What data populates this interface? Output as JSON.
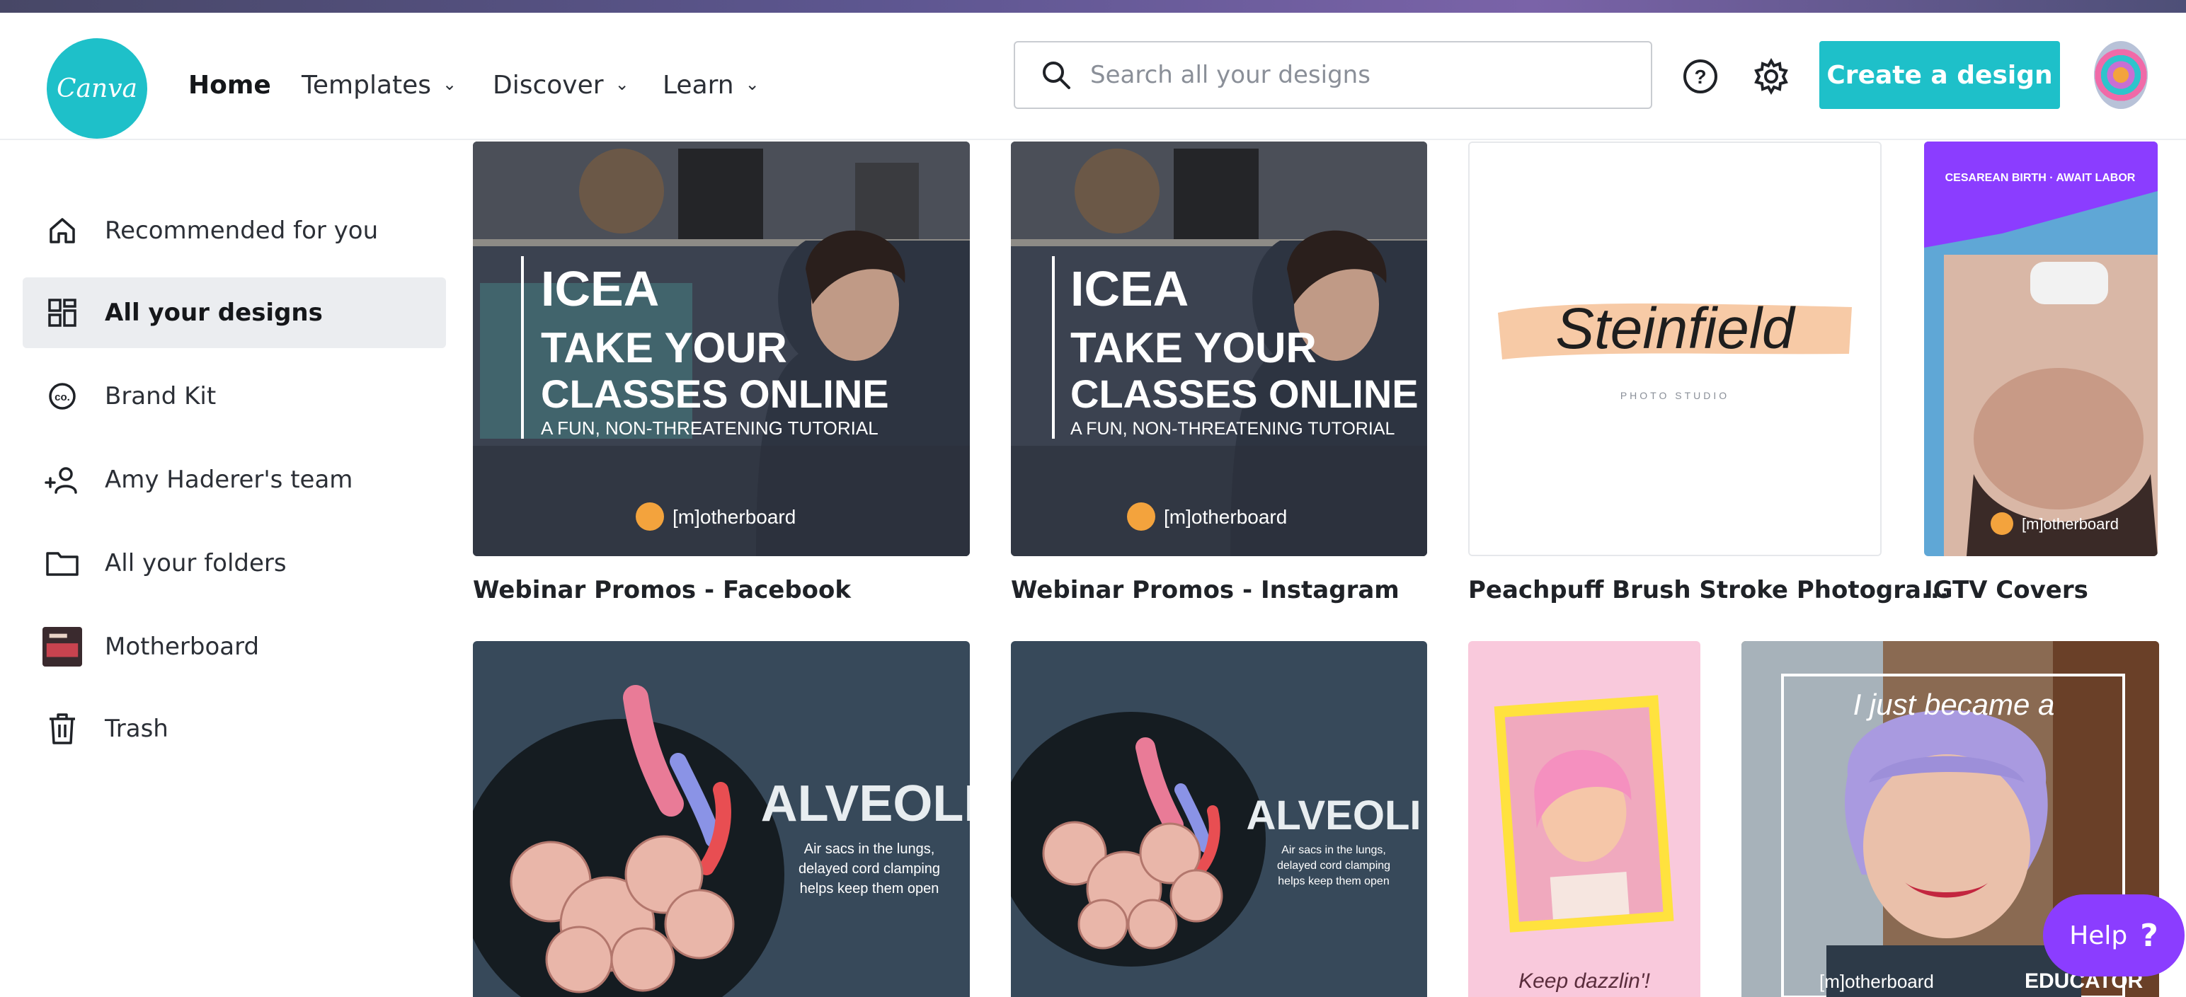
{
  "header": {
    "logo_text": "Canva",
    "nav": [
      {
        "label": "Home",
        "active": true,
        "dropdown": false
      },
      {
        "label": "Templates",
        "active": false,
        "dropdown": true
      },
      {
        "label": "Discover",
        "active": false,
        "dropdown": true
      },
      {
        "label": "Learn",
        "active": false,
        "dropdown": true
      }
    ],
    "search": {
      "placeholder": "Search all your designs",
      "value": ""
    },
    "help_icon": "question-circle-icon",
    "settings_icon": "gear-icon",
    "create_button": "Create a design",
    "accent_color": "#1ec0c9"
  },
  "sidebar": {
    "items": [
      {
        "label": "Recommended for you",
        "icon": "home-icon",
        "active": false
      },
      {
        "label": "All your designs",
        "icon": "grid-icon",
        "active": true
      },
      {
        "label": "Brand Kit",
        "icon": "brand-kit-icon",
        "active": false
      },
      {
        "label": "Amy Haderer's team",
        "icon": "team-icon",
        "active": false
      },
      {
        "label": "All your folders",
        "icon": "folder-icon",
        "active": false
      },
      {
        "label": "Motherboard",
        "icon": "folder-thumbnail",
        "active": false
      },
      {
        "label": "Trash",
        "icon": "trash-icon",
        "active": false
      }
    ]
  },
  "designs": {
    "row1": [
      {
        "title": "Webinar Promos - Facebook",
        "thumb": {
          "logo": "ICEA",
          "line1": "TAKE YOUR",
          "line2": "CLASSES ONLINE",
          "line3": "A FUN, NON-THREATENING TUTORIAL",
          "brand": "[m]otherboard"
        }
      },
      {
        "title": "Webinar Promos - Instagram",
        "thumb": {
          "logo": "ICEA",
          "line1": "TAKE YOUR",
          "line2": "CLASSES ONLINE",
          "line3": "A FUN, NON-THREATENING TUTORIAL",
          "brand": "[m]otherboard"
        }
      },
      {
        "title": "Peachpuff Brush Stroke Photogra...",
        "thumb": {
          "script": "Steinfield",
          "sub": "PHOTO STUDIO"
        }
      },
      {
        "title": "IGTV Covers",
        "thumb": {
          "banner": "CESAREAN BIRTH · AWAIT LABOR",
          "brand": "[m]otherboard"
        }
      }
    ],
    "row2": [
      {
        "thumb": {
          "heading": "ALVEOLI",
          "lines": [
            "Air sacs in the lungs,",
            "delayed cord clamping",
            "helps keep them open"
          ]
        }
      },
      {
        "thumb": {
          "heading": "ALVEOLI",
          "lines": [
            "Air sacs in the lungs,",
            "delayed cord clamping",
            "helps keep them open"
          ]
        }
      },
      {
        "thumb": {
          "script": "Keep dazzlin'!"
        }
      },
      {
        "thumb": {
          "script": "I just became a",
          "brand": "[m]otherboard",
          "badge": "EDUCATOR"
        }
      }
    ]
  },
  "help_button": {
    "label": "Help",
    "glyph": "?"
  }
}
